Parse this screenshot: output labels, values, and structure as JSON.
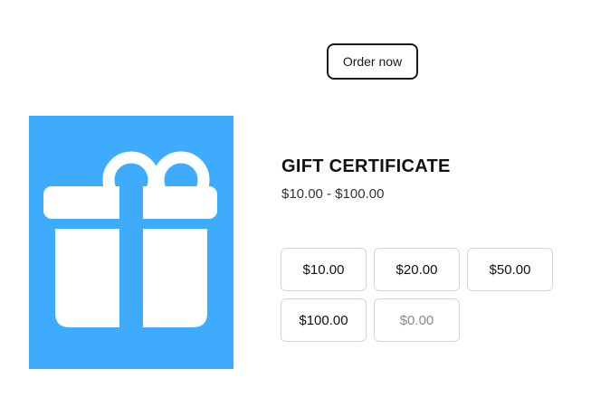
{
  "header": {
    "order_button_label": "Order now"
  },
  "product": {
    "image_icon": "gift-icon",
    "image_background": "#3eabfc",
    "title": "GIFT CERTIFICATE",
    "price_range": "$10.00 - $100.00"
  },
  "amounts": {
    "options": [
      "$10.00",
      "$20.00",
      "$50.00",
      "$100.00"
    ],
    "custom_placeholder": "$0.00"
  }
}
